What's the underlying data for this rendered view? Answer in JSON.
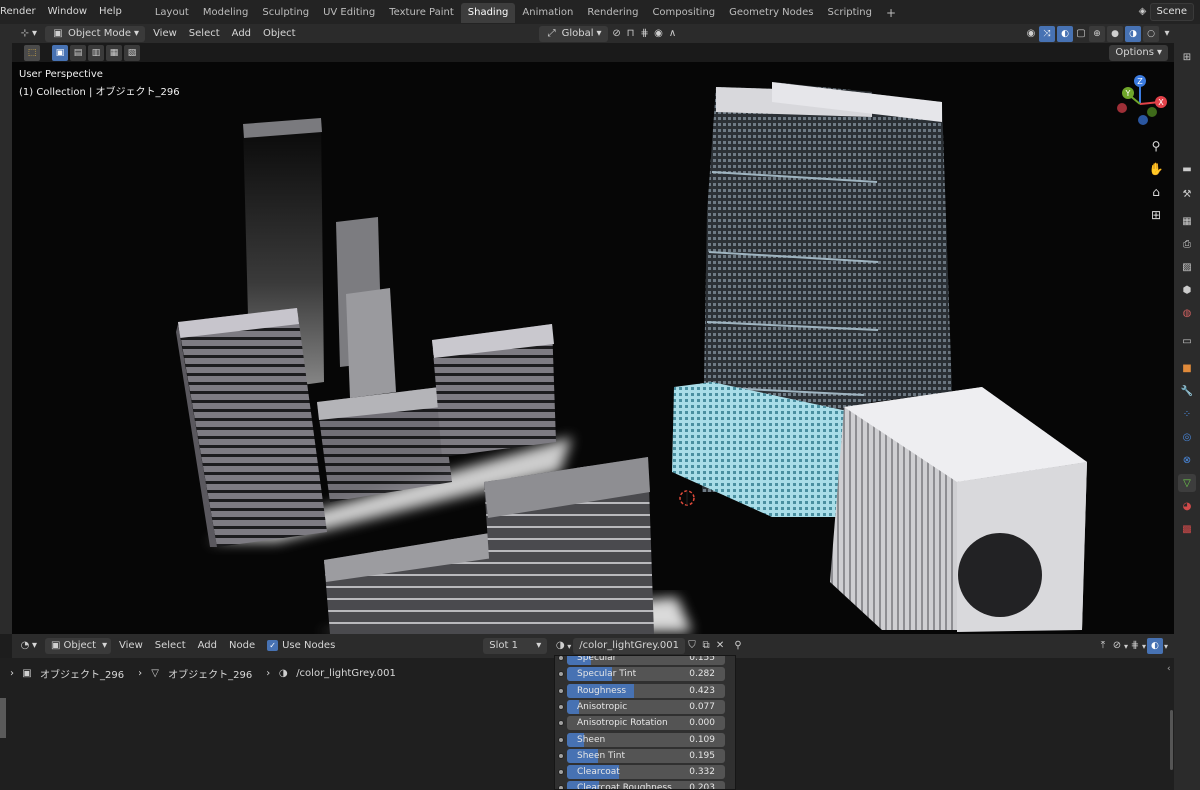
{
  "menu": {
    "items": [
      "Render",
      "Window",
      "Help"
    ]
  },
  "workspaces": {
    "tabs": [
      "Layout",
      "Modeling",
      "Sculpting",
      "UV Editing",
      "Texture Paint",
      "Shading",
      "Animation",
      "Rendering",
      "Compositing",
      "Geometry Nodes",
      "Scripting"
    ],
    "active": "Shading",
    "add_label": "+"
  },
  "scene": {
    "name": "Scene"
  },
  "viewport_header": {
    "mode": "Object Mode",
    "menus": [
      "View",
      "Select",
      "Add",
      "Object"
    ],
    "transform_orientation": "Global",
    "options_label": "Options"
  },
  "viewport": {
    "perspective_label": "User Perspective",
    "collection_label": "(1) Collection | オブジェクト_296",
    "gizmo": {
      "x": "X",
      "y": "Y",
      "z": "Z"
    }
  },
  "node_editor": {
    "object_type": "Object",
    "menus": [
      "View",
      "Select",
      "Add",
      "Node"
    ],
    "use_nodes_label": "Use Nodes",
    "slot": "Slot 1",
    "material_name": "/color_lightGrey.001",
    "breadcrumb": [
      "オブジェクト_296",
      "オブジェクト_296",
      "/color_lightGrey.001"
    ]
  },
  "node_params": [
    {
      "name": "Specular",
      "value": "0.155",
      "fraction": 0.155
    },
    {
      "name": "Specular Tint",
      "value": "0.282",
      "fraction": 0.282
    },
    {
      "name": "Roughness",
      "value": "0.423",
      "fraction": 0.423
    },
    {
      "name": "Anisotropic",
      "value": "0.077",
      "fraction": 0.077
    },
    {
      "name": "Anisotropic Rotation",
      "value": "0.000",
      "fraction": 0.0
    },
    {
      "name": "Sheen",
      "value": "0.109",
      "fraction": 0.109
    },
    {
      "name": "Sheen Tint",
      "value": "0.195",
      "fraction": 0.195
    },
    {
      "name": "Clearcoat",
      "value": "0.332",
      "fraction": 0.332
    },
    {
      "name": "Clearcoat Roughness",
      "value": "0.203",
      "fraction": 0.203
    }
  ],
  "colors": {
    "accent": "#4772b3",
    "panel": "#2b2b2b",
    "viewport_bg": "#060606",
    "x_axis": "#e2424a",
    "y_axis": "#6fa52a",
    "z_axis": "#3b7be0"
  }
}
